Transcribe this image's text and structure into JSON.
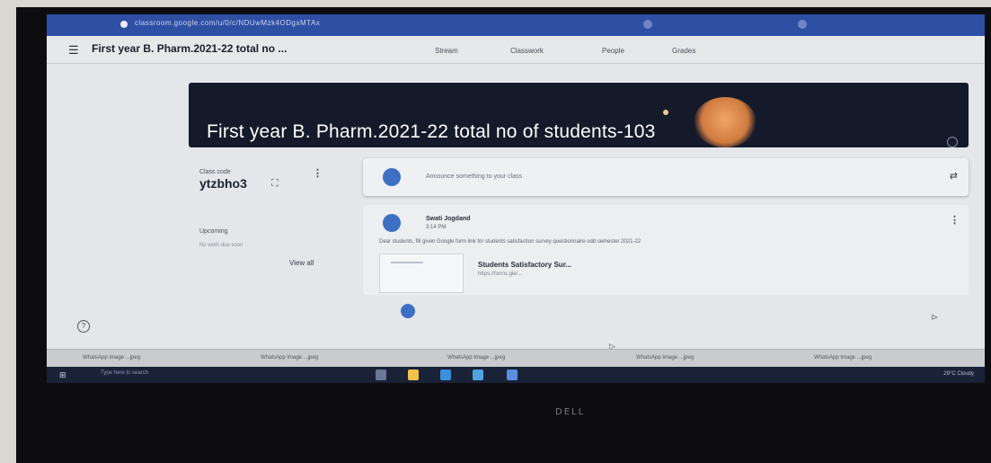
{
  "browser": {
    "url": "classroom.google.com/u/0/c/NDUwMzk4ODgxMTAx"
  },
  "header": {
    "class_title": "First year B. Pharm.2021-22 total no ...",
    "tabs": [
      "Stream",
      "Classwork",
      "People",
      "Grades"
    ]
  },
  "banner": {
    "title": "First year B. Pharm.2021-22 total no of students-103"
  },
  "sidebar": {
    "class_code_label": "Class code",
    "class_code": "ytzbho3",
    "upcoming_label": "Upcoming",
    "upcoming_text": "No work due soon",
    "view_all": "View all"
  },
  "announce": {
    "placeholder": "Announce something to your class"
  },
  "post": {
    "author": "Swati Jogdand",
    "time": "3:14 PM",
    "body": "Dear students, fill given Google form link for students satisfaction survey questionnaire odd semester 2021-22",
    "attachment_title": "Students Satisfactory Sur...",
    "attachment_url": "https://forms.gle/..."
  },
  "downloads": [
    "WhatsApp Image ...jpeg",
    "WhatsApp Image ...jpeg",
    "WhatsApp Image ...jpeg",
    "WhatsApp Image ...jpeg",
    "WhatsApp Image ...jpeg"
  ],
  "taskbar": {
    "search_placeholder": "Type here to search",
    "tray": "29°C Cloudy"
  },
  "laptop": {
    "brand": "DELL"
  },
  "colors": {
    "banner_bg": "#141a2a",
    "accent": "#3d6fc4",
    "taskbar": "#1a2238"
  }
}
